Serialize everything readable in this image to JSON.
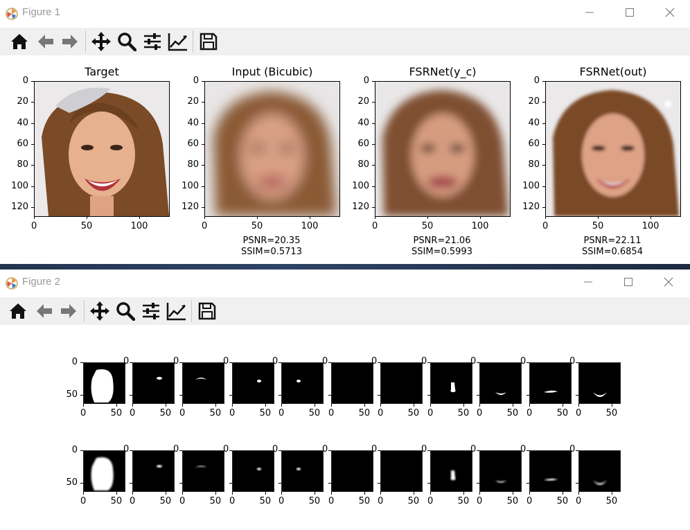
{
  "figure1": {
    "title": "Figure 1",
    "panels": [
      {
        "title": "Target",
        "psnr": "",
        "ssim": ""
      },
      {
        "title": "Input (Bicubic)",
        "psnr": "PSNR=20.35",
        "ssim": "SSIM=0.5713"
      },
      {
        "title": "FSRNet(y_c)",
        "psnr": "PSNR=21.06",
        "ssim": "SSIM=0.5993"
      },
      {
        "title": "FSRNet(out)",
        "psnr": "PSNR=22.11",
        "ssim": "SSIM=0.6854"
      }
    ],
    "y_ticks": [
      "0",
      "20",
      "40",
      "60",
      "80",
      "100",
      "120"
    ],
    "x_ticks": [
      "0",
      "50",
      "100"
    ]
  },
  "figure2": {
    "title": "Figure 2",
    "y_ticks": [
      "0",
      "50"
    ],
    "x_ticks": [
      "0",
      "50"
    ],
    "rows": 2,
    "cols": 11
  },
  "toolbar_icons": [
    "home-icon",
    "back-arrow-icon",
    "forward-arrow-icon",
    "pan-icon",
    "zoom-icon",
    "configure-subplots-icon",
    "edit-axis-icon",
    "save-icon"
  ],
  "colors": {
    "toolbar_bg": "#f0f0f0",
    "title_text": "#999999",
    "mask_bg": "#000000",
    "mask_fg": "#ffffff"
  }
}
